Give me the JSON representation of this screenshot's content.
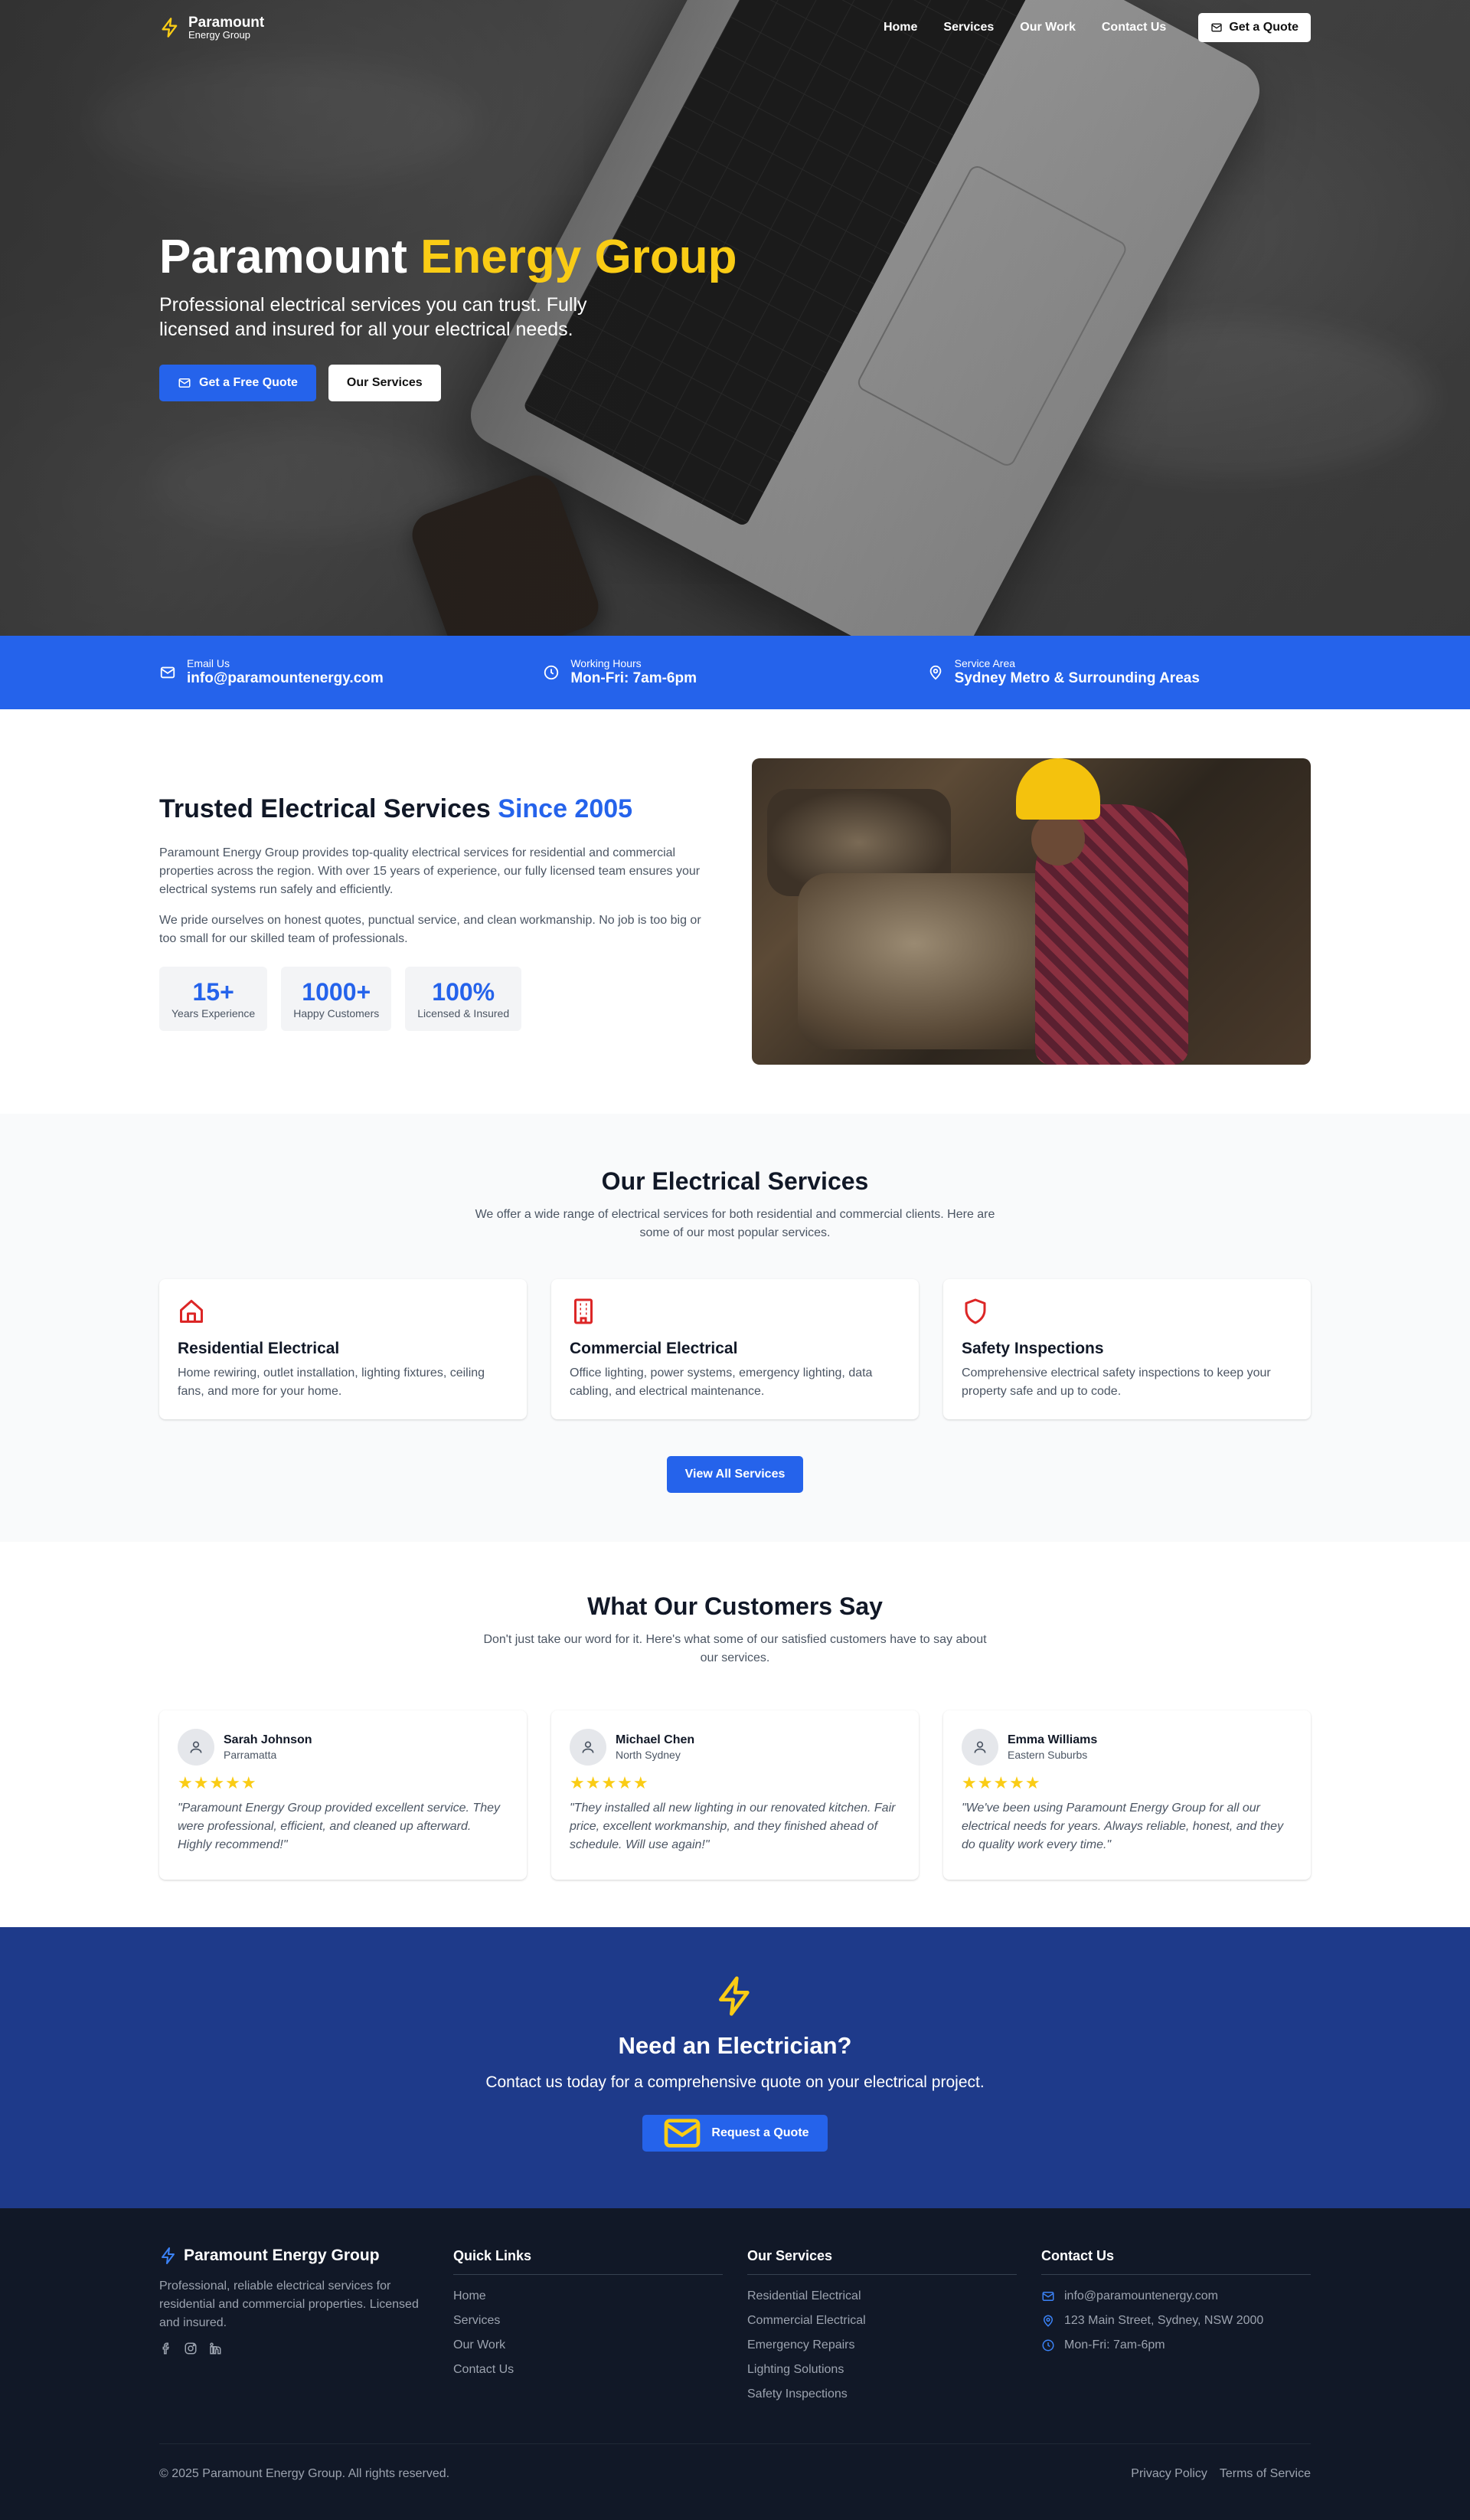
{
  "brand": {
    "name": "Paramount",
    "tagline": "Energy Group",
    "full": "Paramount Energy Group"
  },
  "nav": {
    "items": [
      "Home",
      "Services",
      "Our Work",
      "Contact Us"
    ],
    "cta": "Get a Quote"
  },
  "hero": {
    "title_main": "Paramount",
    "title_accent": "Energy Group",
    "subtitle": "Professional electrical services you can trust. Fully licensed and insured for all your electrical needs.",
    "primary_btn": "Get a Free Quote",
    "secondary_btn": "Our Services"
  },
  "infobar": [
    {
      "label": "Email Us",
      "value": "info@paramountenergy.com",
      "icon": "mail-icon"
    },
    {
      "label": "Working Hours",
      "value": "Mon-Fri: 7am-6pm",
      "icon": "clock-icon"
    },
    {
      "label": "Service Area",
      "value": "Sydney Metro & Surrounding Areas",
      "icon": "map-pin-icon"
    }
  ],
  "about": {
    "title_main": "Trusted Electrical Services",
    "title_accent": "Since 2005",
    "p1": "Paramount Energy Group provides top-quality electrical services for residential and commercial properties across the region. With over 15 years of experience, our fully licensed team ensures your electrical systems run safely and efficiently.",
    "p2": "We pride ourselves on honest quotes, punctual service, and clean workmanship. No job is too big or too small for our skilled team of professionals.",
    "stats": [
      {
        "value": "15+",
        "label": "Years Experience"
      },
      {
        "value": "1000+",
        "label": "Happy Customers"
      },
      {
        "value": "100%",
        "label": "Licensed & Insured"
      }
    ]
  },
  "services": {
    "title": "Our Electrical Services",
    "subtitle": "We offer a wide range of electrical services for both residential and commercial clients. Here are some of our most popular services.",
    "cards": [
      {
        "title": "Residential Electrical",
        "desc": "Home rewiring, outlet installation, lighting fixtures, ceiling fans, and more for your home.",
        "icon": "home-icon"
      },
      {
        "title": "Commercial Electrical",
        "desc": "Office lighting, power systems, emergency lighting, data cabling, and electrical maintenance.",
        "icon": "building-icon"
      },
      {
        "title": "Safety Inspections",
        "desc": "Comprehensive electrical safety inspections to keep your property safe and up to code.",
        "icon": "shield-icon"
      }
    ],
    "button": "View All Services"
  },
  "testimonials": {
    "title": "What Our Customers Say",
    "subtitle": "Don't just take our word for it. Here's what some of our satisfied customers have to say about our services.",
    "items": [
      {
        "name": "Sarah Johnson",
        "location": "Parramatta",
        "rating": 5,
        "stars": "★★★★★",
        "quote": "\"Paramount Energy Group provided excellent service. They were professional, efficient, and cleaned up afterward. Highly recommend!\""
      },
      {
        "name": "Michael Chen",
        "location": "North Sydney",
        "rating": 5,
        "stars": "★★★★★",
        "quote": "\"They installed all new lighting in our renovated kitchen. Fair price, excellent workmanship, and they finished ahead of schedule. Will use again!\""
      },
      {
        "name": "Emma Williams",
        "location": "Eastern Suburbs",
        "rating": 5,
        "stars": "★★★★★",
        "quote": "\"We've been using Paramount Energy Group for all our electrical needs for years. Always reliable, honest, and they do quality work every time.\""
      }
    ]
  },
  "cta": {
    "title": "Need an Electrician?",
    "subtitle": "Contact us today for a comprehensive quote on your electrical project.",
    "button": "Request a Quote"
  },
  "footer": {
    "brand": "Paramount Energy Group",
    "desc": "Professional, reliable electrical services for residential and commercial properties. Licensed and insured.",
    "quick_title": "Quick Links",
    "quick": [
      "Home",
      "Services",
      "Our Work",
      "Contact Us"
    ],
    "services_title": "Our Services",
    "services": [
      "Residential Electrical",
      "Commercial Electrical",
      "Emergency Repairs",
      "Lighting Solutions",
      "Safety Inspections"
    ],
    "contact_title": "Contact Us",
    "contact": [
      "info@paramountenergy.com",
      "123 Main Street, Sydney, NSW 2000",
      "Mon-Fri: 7am-6pm"
    ],
    "copyright": "© 2025 Paramount Energy Group. All rights reserved.",
    "privacy": "Privacy Policy",
    "terms": "Terms of Service"
  },
  "colors": {
    "primary": "#2563eb",
    "accent": "#facc15",
    "dark_blue": "#1e3a8a",
    "footer": "#111827",
    "icon_red": "#dc2626"
  }
}
